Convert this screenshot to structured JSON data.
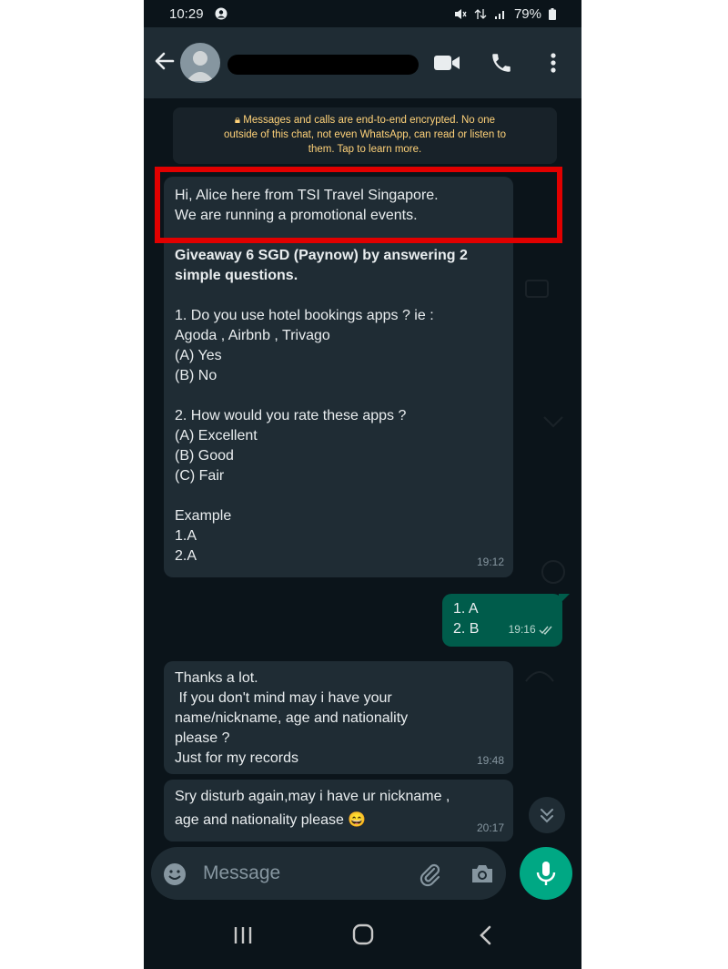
{
  "status_bar": {
    "time": "10:29",
    "battery": "79%"
  },
  "header": {
    "contact_name_redacted": true
  },
  "encryption_notice": {
    "lines": [
      "Messages and calls are end-to-end encrypted. No one",
      "outside of this chat, not even WhatsApp, can read or listen to",
      "them. Tap to learn more."
    ]
  },
  "messages": [
    {
      "direction": "in",
      "lines": [
        "Hi, Alice here from TSI Travel Singapore.",
        "We are running a promotional events.",
        "",
        "Giveaway 6 SGD (Paynow) by answering 2",
        "simple questions.",
        "",
        "1. Do you use hotel bookings apps ? ie :",
        "Agoda , Airbnb , Trivago",
        "(A) Yes",
        "(B) No",
        "",
        "2. How would you rate these apps ?",
        "(A) Excellent",
        "(B) Good",
        "(C) Fair",
        "",
        "Example",
        "1.A",
        "2.A"
      ],
      "time": "19:12"
    },
    {
      "direction": "out",
      "lines": [
        "1. A",
        "2. B"
      ],
      "time": "19:16",
      "status": "read"
    },
    {
      "direction": "in",
      "lines": [
        "Thanks a lot.",
        " If you don't mind may i have your",
        "name/nickname, age and nationality",
        "please ?",
        "Just for my records"
      ],
      "time": "19:48"
    },
    {
      "direction": "in",
      "lines": [
        "Sry disturb again,may i have ur nickname ,",
        "age and nationality please"
      ],
      "emoji": "😄",
      "time": "20:17"
    }
  ],
  "input": {
    "placeholder": "Message"
  },
  "colors": {
    "chat_bg": "#0b141a",
    "bubble_in": "#1f2c34",
    "bubble_out": "#005c4b",
    "accent": "#00a884",
    "encryption_text": "#ffd279",
    "highlight": "#e10000"
  }
}
